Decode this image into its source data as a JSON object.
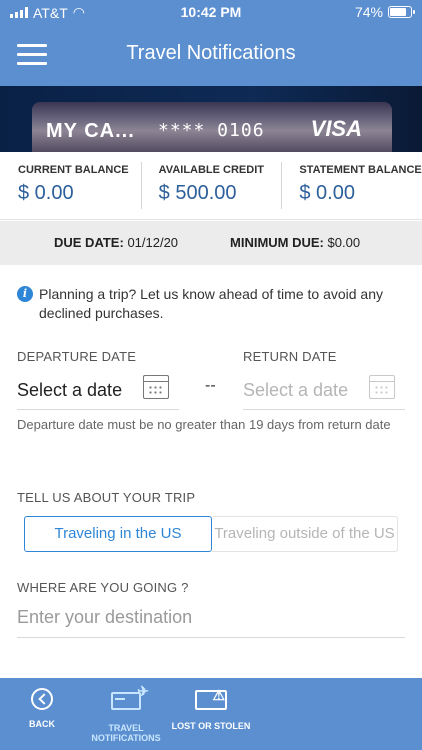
{
  "status": {
    "carrier": "AT&T",
    "time": "10:42 PM",
    "battery": "74%"
  },
  "header": {
    "title": "Travel Notifications"
  },
  "card": {
    "name": "MY CA...",
    "number": "**** 0106",
    "brand": "VISA"
  },
  "balances": [
    {
      "label": "CURRENT BALANCE",
      "value": "$ 0.00"
    },
    {
      "label": "AVAILABLE CREDIT",
      "value": "$ 500.00"
    },
    {
      "label": "STATEMENT BALANCE",
      "value": "$ 0.00"
    }
  ],
  "due": {
    "due_label": "DUE DATE:",
    "due_value": "01/12/20",
    "min_label": "MINIMUM DUE:",
    "min_value": "$0.00"
  },
  "info": {
    "text": "Planning a trip? Let us know ahead of time to avoid any declined purchases."
  },
  "form": {
    "departure_label": "DEPARTURE DATE",
    "departure_value": "Select a date",
    "return_label": "RETURN DATE",
    "return_value": "Select a date",
    "separator": "--",
    "hint": "Departure date must be no greater than 19 days from return date",
    "trip_label": "TELL US ABOUT YOUR TRIP",
    "trip_options": [
      "Traveling in the US",
      "Traveling outside of the US"
    ],
    "destination_label": "WHERE ARE YOU GOING ?",
    "destination_placeholder": "Enter your destination"
  },
  "tabs": [
    {
      "label": "BACK"
    },
    {
      "label": "TRAVEL NOTIFICATIONS"
    },
    {
      "label": "LOST OR STOLEN"
    }
  ]
}
